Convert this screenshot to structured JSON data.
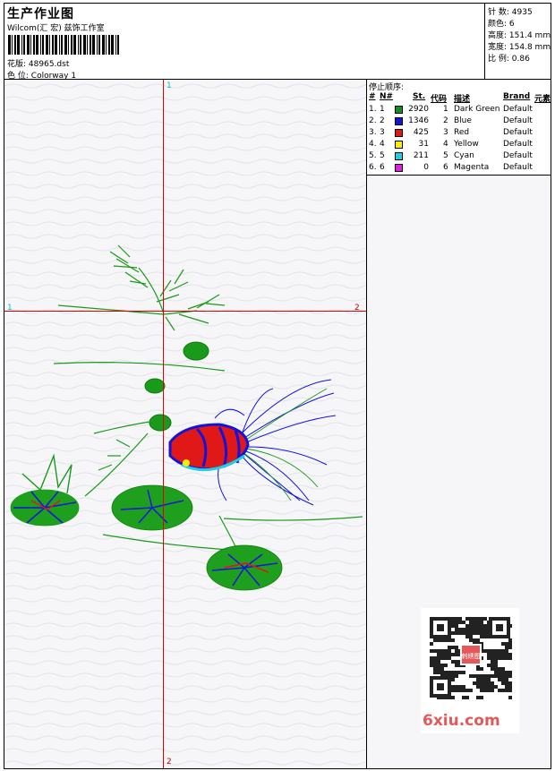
{
  "header": {
    "title": "生产作业图",
    "company": "Wilcom(汇 宏) 兹饰工作室",
    "design_label": "花版:",
    "design_value": "48965.dst",
    "colorway_label": "色 位:",
    "colorway_value": "Colorway 1"
  },
  "stats": [
    {
      "label": "针 数:",
      "value": "4935"
    },
    {
      "label": "颜色:",
      "value": "6"
    },
    {
      "label": "高度:",
      "value": "151.4 mm"
    },
    {
      "label": "宽度:",
      "value": "154.8 mm"
    },
    {
      "label": "比 例:",
      "value": "0.86"
    }
  ],
  "stop_sequence": {
    "title": "停止顺序:",
    "headers": {
      "num": "#",
      "n": "N#",
      "st": "St.",
      "code": "代码",
      "desc": "描述",
      "brand": "Brand",
      "element": "元素"
    },
    "rows": [
      {
        "num": "1.",
        "n": "1",
        "color": "#0f8f1f",
        "st": "2920",
        "code": "1",
        "desc": "Dark Green",
        "brand": "Default"
      },
      {
        "num": "2.",
        "n": "2",
        "color": "#1414d8",
        "st": "1346",
        "code": "2",
        "desc": "Blue",
        "brand": "Default"
      },
      {
        "num": "3.",
        "n": "3",
        "color": "#e01818",
        "st": "425",
        "code": "3",
        "desc": "Red",
        "brand": "Default"
      },
      {
        "num": "4.",
        "n": "4",
        "color": "#f4f000",
        "st": "31",
        "code": "4",
        "desc": "Yellow",
        "brand": "Default"
      },
      {
        "num": "5.",
        "n": "5",
        "color": "#20d0e0",
        "st": "211",
        "code": "5",
        "desc": "Cyan",
        "brand": "Default"
      },
      {
        "num": "6.",
        "n": "6",
        "color": "#e020e0",
        "st": "0",
        "code": "6",
        "desc": "Magenta",
        "brand": "Default"
      }
    ]
  },
  "axes": {
    "top": "1",
    "left": "1",
    "right": "2",
    "bottom": "2"
  },
  "watermark": {
    "qr_text": "刺绣图",
    "site": "6xiu.com"
  }
}
